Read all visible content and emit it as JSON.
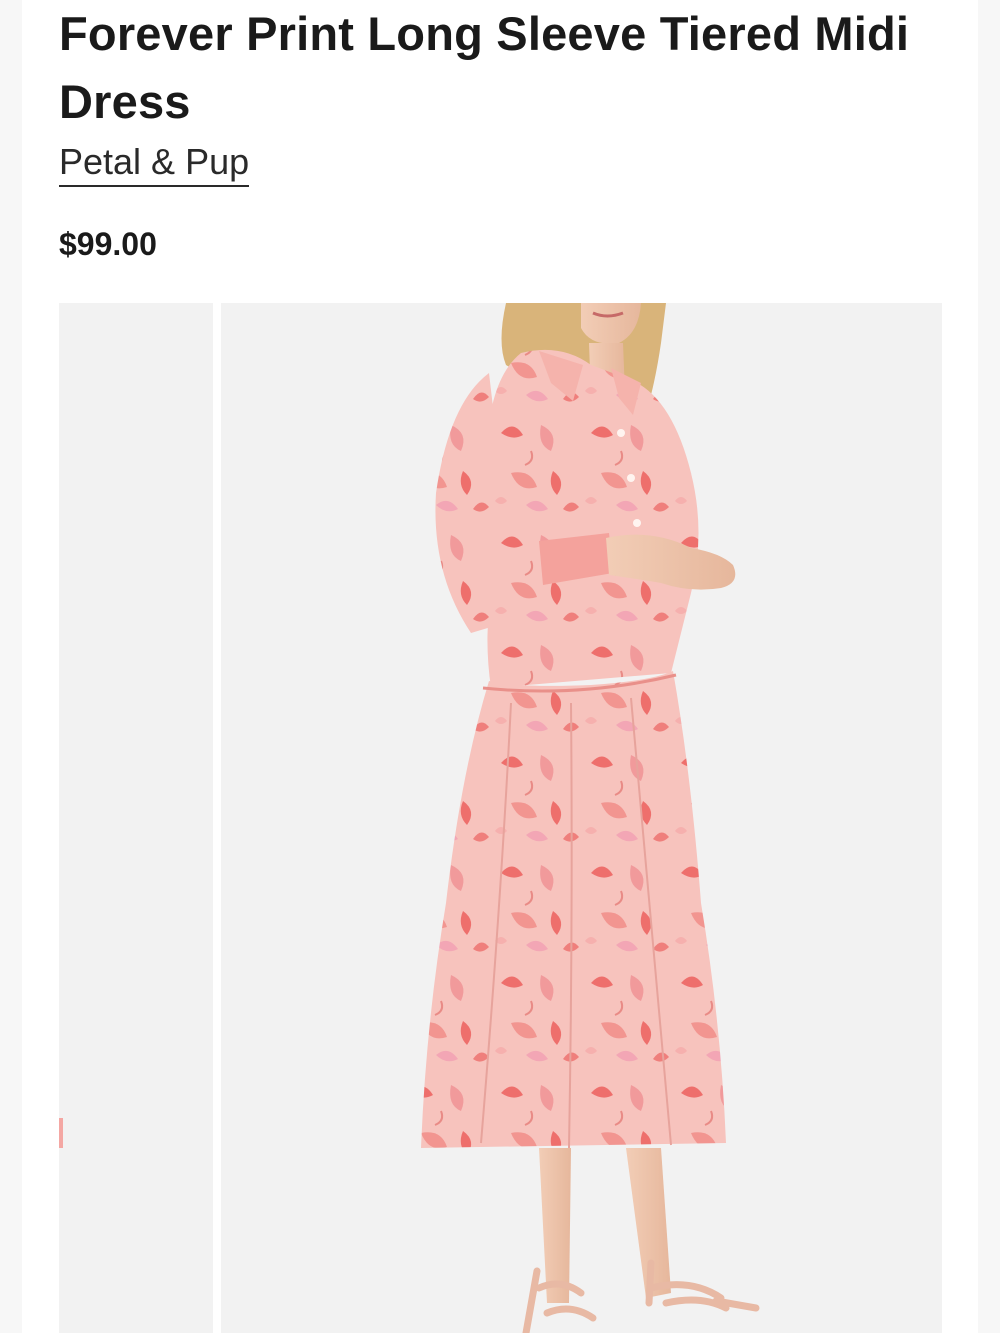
{
  "product": {
    "title": "Forever Print Long Sleeve Tiered Midi Dress",
    "brand": "Petal & Pup",
    "price": "$99.00"
  },
  "gallery": {
    "main_image": "pink floral long-sleeve tiered midi dress worn by model",
    "previous_image": "partially visible previous product image"
  },
  "colors": {
    "dress_pink": "#f7c3bd",
    "print_coral": "#ee6f6c",
    "print_rose": "#f19a9b",
    "image_background": "#f2f2f2",
    "sandal_nude": "#e8b9a4",
    "hair_blonde": "#d9b47a",
    "text": "#1a1a1a"
  }
}
